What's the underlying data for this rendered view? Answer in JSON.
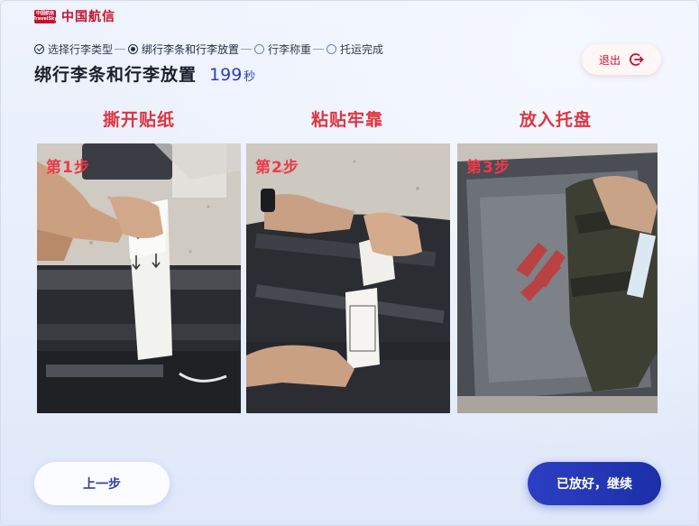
{
  "brand": {
    "badge_line1": "中国航信",
    "badge_line2": "TravelSky",
    "name": "中国航信"
  },
  "steps": [
    {
      "label": "选择行李类型",
      "state": "done"
    },
    {
      "label": "绑行李条和行李放置",
      "state": "current"
    },
    {
      "label": "行李称重",
      "state": "todo"
    },
    {
      "label": "托运完成",
      "state": "todo"
    }
  ],
  "header": {
    "title": "绑行李条和行李放置",
    "countdown": "199",
    "countdown_unit": "秒"
  },
  "exit_button": {
    "label": "退出",
    "icon": "exit-icon"
  },
  "instructions": [
    {
      "title": "撕开贴纸",
      "tag": "第1步"
    },
    {
      "title": "粘贴牢靠",
      "tag": "第2步"
    },
    {
      "title": "放入托盘",
      "tag": "第3步"
    }
  ],
  "footer": {
    "prev_label": "上一步",
    "next_label": "已放好，继续"
  },
  "colors": {
    "accent": "#2b3fbf",
    "brand_red": "#c8102e",
    "step_title": "#e0343f"
  }
}
